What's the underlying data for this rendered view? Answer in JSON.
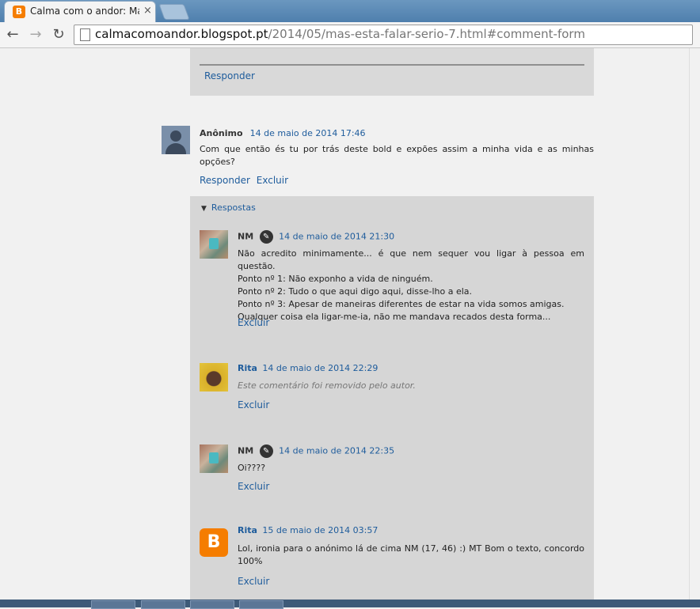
{
  "browser": {
    "tab_title": "Calma com o andor: Mas",
    "tab_close": "×",
    "favicon_letter": "B",
    "url_host": "calmacomoandor.blogspot.pt",
    "url_path": "/2014/05/mas-esta-falar-serio-7.html#comment-form",
    "back": "←",
    "forward": "→",
    "reload": "↻"
  },
  "top_block": {
    "reply_label": "Responder"
  },
  "comment": {
    "author": "Anônimo",
    "date": "14 de maio de 2014 17:46",
    "text": "Com que então és tu por trás deste bold e expões assim a minha vida e as minhas opções?",
    "reply_label": "Responder",
    "delete_label": "Excluir"
  },
  "replies": {
    "toggle_label": "Respostas",
    "items": [
      {
        "author": "NM",
        "date": "14 de maio de 2014 21:30",
        "lines": [
          "Não acredito minimamente... é que nem sequer vou ligar à pessoa em questão.",
          "Ponto nº 1: Não exponho a vida de ninguém.",
          "Ponto nº 2: Tudo o que aqui digo aqui, disse-lho a ela.",
          "Ponto nº 3: Apesar de maneiras diferentes de estar na vida somos amigas.",
          "Qualquer coisa ela ligar-me-ia, não me mandava recados desta forma..."
        ],
        "delete_label": "Excluir"
      },
      {
        "author": "Rita",
        "date": "14 de maio de 2014 22:29",
        "removed": "Este comentário foi removido pelo autor.",
        "delete_label": "Excluir"
      },
      {
        "author": "NM",
        "date": "14 de maio de 2014 22:35",
        "text": "Oi????",
        "delete_label": "Excluir"
      },
      {
        "author": "Rita",
        "date": "15 de maio de 2014 03:57",
        "text": "Lol, ironia para o anónimo lá de cima NM (17, 46) :) MT Bom o texto, concordo 100%",
        "delete_label": "Excluir"
      }
    ]
  },
  "icons": {
    "pencil": "✎",
    "blogger_letter": "B",
    "arrow": "▼"
  }
}
